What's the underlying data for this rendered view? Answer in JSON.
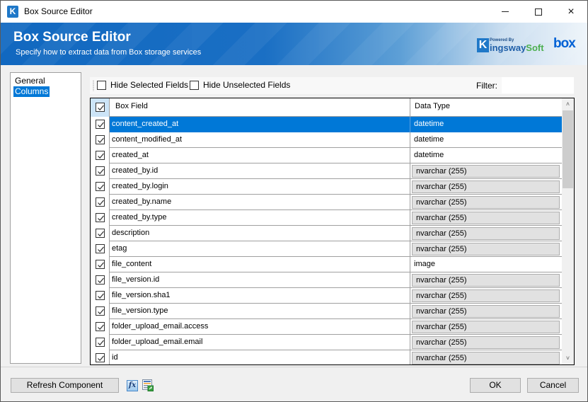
{
  "window": {
    "title": "Box Source Editor",
    "controls": {
      "minimize": "minimize",
      "maximize": "maximize",
      "close": "×"
    }
  },
  "banner": {
    "title": "Box Source Editor",
    "subtitle": "Specify how to extract data from Box storage services",
    "kingsway_logo": {
      "k": "K",
      "powered_by": "Powered By",
      "name_main": "ingsway",
      "name_soft": "Soft"
    },
    "box_logo": "box"
  },
  "nav": {
    "items": [
      {
        "label": "General",
        "selected": false
      },
      {
        "label": "Columns",
        "selected": true
      }
    ]
  },
  "toolbar": {
    "hide_selected_label": "Hide Selected Fields",
    "hide_selected_checked": false,
    "hide_unselected_label": "Hide Unselected Fields",
    "hide_unselected_checked": false,
    "filter_label": "Filter:",
    "filter_value": ""
  },
  "grid": {
    "columns": {
      "select_all_checked": true,
      "field": "Box Field",
      "type": "Data Type"
    },
    "rows": [
      {
        "checked": true,
        "field": "content_created_at",
        "type": "datetime",
        "editable": true,
        "selected": true
      },
      {
        "checked": true,
        "field": "content_modified_at",
        "type": "datetime",
        "editable": true,
        "selected": false
      },
      {
        "checked": true,
        "field": "created_at",
        "type": "datetime",
        "editable": true,
        "selected": false
      },
      {
        "checked": true,
        "field": "created_by.id",
        "type": "nvarchar (255)",
        "editable": false,
        "selected": false
      },
      {
        "checked": true,
        "field": "created_by.login",
        "type": "nvarchar (255)",
        "editable": false,
        "selected": false
      },
      {
        "checked": true,
        "field": "created_by.name",
        "type": "nvarchar (255)",
        "editable": false,
        "selected": false
      },
      {
        "checked": true,
        "field": "created_by.type",
        "type": "nvarchar (255)",
        "editable": false,
        "selected": false
      },
      {
        "checked": true,
        "field": "description",
        "type": "nvarchar (255)",
        "editable": false,
        "selected": false
      },
      {
        "checked": true,
        "field": "etag",
        "type": "nvarchar (255)",
        "editable": false,
        "selected": false
      },
      {
        "checked": true,
        "field": "file_content",
        "type": "image",
        "editable": true,
        "selected": false
      },
      {
        "checked": true,
        "field": "file_version.id",
        "type": "nvarchar (255)",
        "editable": false,
        "selected": false
      },
      {
        "checked": true,
        "field": "file_version.sha1",
        "type": "nvarchar (255)",
        "editable": false,
        "selected": false
      },
      {
        "checked": true,
        "field": "file_version.type",
        "type": "nvarchar (255)",
        "editable": false,
        "selected": false
      },
      {
        "checked": true,
        "field": "folder_upload_email.access",
        "type": "nvarchar (255)",
        "editable": false,
        "selected": false
      },
      {
        "checked": true,
        "field": "folder_upload_email.email",
        "type": "nvarchar (255)",
        "editable": false,
        "selected": false
      },
      {
        "checked": true,
        "field": "id",
        "type": "nvarchar (255)",
        "editable": false,
        "selected": false
      }
    ],
    "scroll": {
      "up_arrow": "▲",
      "down_arrow": "▼"
    }
  },
  "footer": {
    "refresh_label": "Refresh Component",
    "expression_icon_label": "fx",
    "ok_label": "OK",
    "cancel_label": "Cancel"
  },
  "colors": {
    "accent": "#0078d7",
    "banner": "#1168c0",
    "readonly_cell": "#e1e1e1",
    "header_check_bg": "#cce4f7"
  }
}
